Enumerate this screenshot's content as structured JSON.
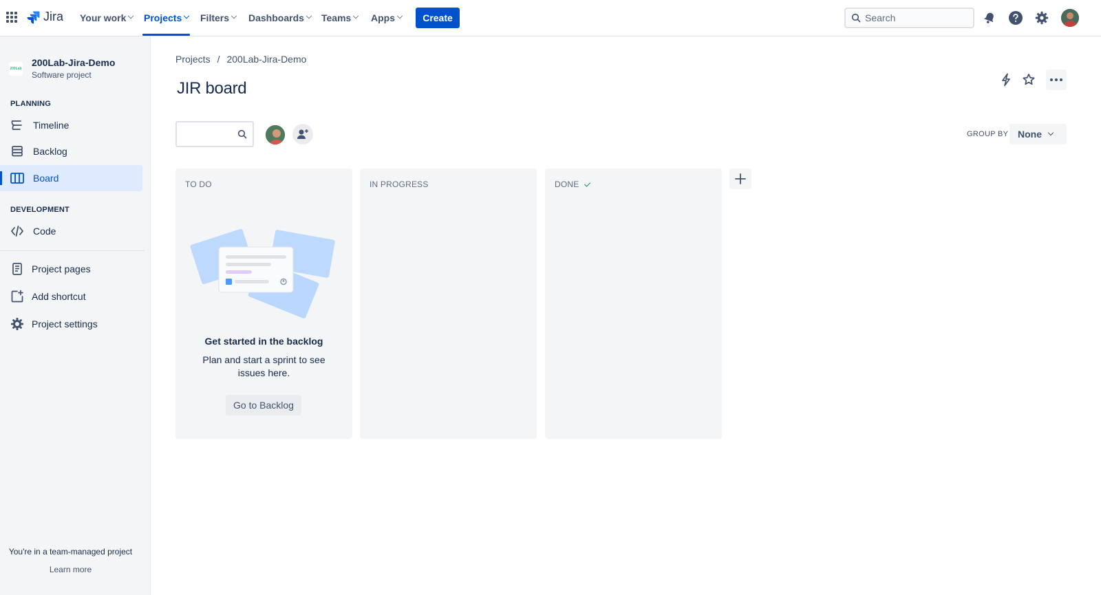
{
  "topnav": {
    "logo_text": "Jira",
    "items": [
      {
        "label": "Your work"
      },
      {
        "label": "Projects"
      },
      {
        "label": "Filters"
      },
      {
        "label": "Dashboards"
      },
      {
        "label": "Teams"
      },
      {
        "label": "Apps"
      }
    ],
    "active_item": "Projects",
    "create_label": "Create",
    "search_placeholder": "Search"
  },
  "sidebar": {
    "project_name": "200Lab-Jira-Demo",
    "project_type": "Software project",
    "project_logo_text": "200Lab",
    "planning_label": "PLANNING",
    "planning_items": [
      {
        "label": "Timeline",
        "icon": "timeline-icon"
      },
      {
        "label": "Backlog",
        "icon": "backlog-icon"
      },
      {
        "label": "Board",
        "icon": "board-icon",
        "active": true
      }
    ],
    "development_label": "DEVELOPMENT",
    "development_items": [
      {
        "label": "Code",
        "icon": "code-icon"
      }
    ],
    "other_items": [
      {
        "label": "Project pages",
        "icon": "page-icon"
      },
      {
        "label": "Add shortcut",
        "icon": "add-shortcut-icon"
      },
      {
        "label": "Project settings",
        "icon": "gear-icon"
      }
    ],
    "footer_text": "You're in a team-managed project",
    "footer_link": "Learn more"
  },
  "main": {
    "breadcrumb": [
      "Projects",
      "200Lab-Jira-Demo"
    ],
    "breadcrumb_separator": "/",
    "title": "JIR board",
    "group_by_label": "GROUP BY",
    "group_by_value": "None",
    "columns": [
      {
        "title": "TO DO"
      },
      {
        "title": "IN PROGRESS"
      },
      {
        "title": "DONE"
      }
    ],
    "empty_state": {
      "title": "Get started in the backlog",
      "description": "Plan and start a sprint to see issues here.",
      "button": "Go to Backlog"
    }
  },
  "colors": {
    "brand": "#0052cc",
    "sidebar_bg": "#f4f5f7",
    "active_bg": "#deebff",
    "done_check": "#00875a"
  }
}
